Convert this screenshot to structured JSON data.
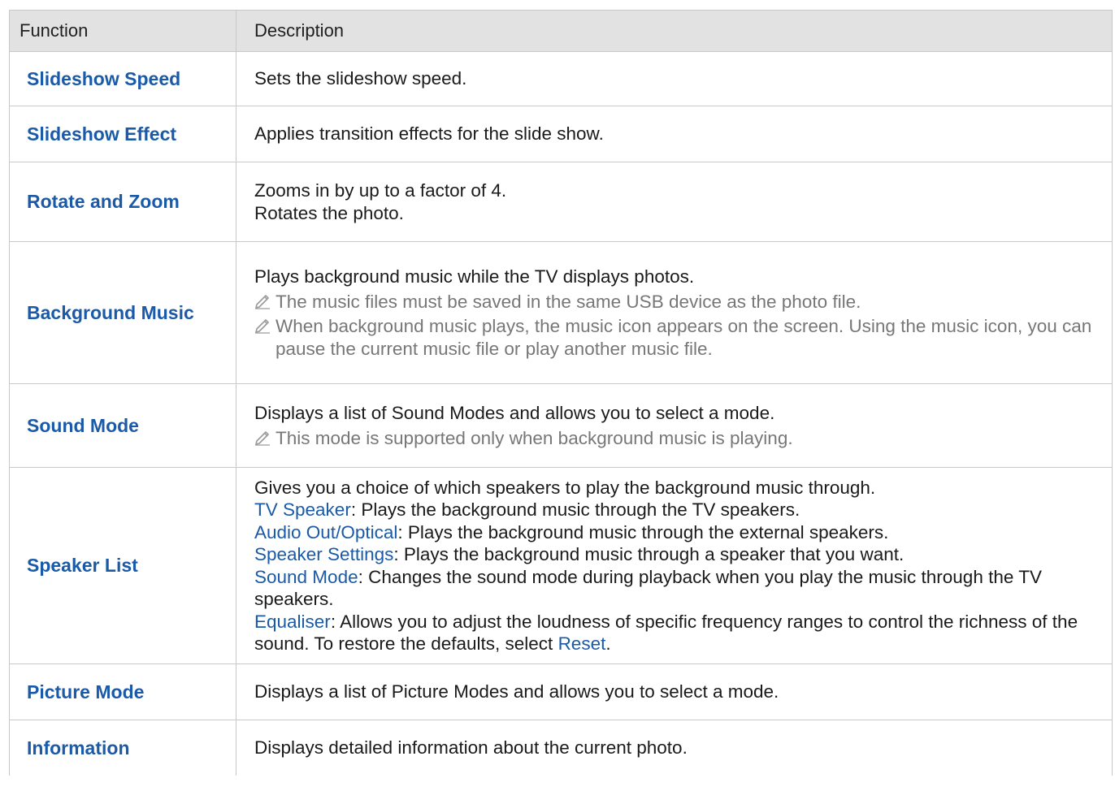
{
  "header": {
    "function_label": "Function",
    "description_label": "Description"
  },
  "rows": [
    {
      "function": "Slideshow Speed",
      "lines": [
        "Sets the slideshow speed."
      ]
    },
    {
      "function": "Slideshow Effect",
      "lines": [
        "Applies transition effects for the slide show."
      ]
    },
    {
      "function": "Rotate and Zoom",
      "lines": [
        "Zooms in by up to a factor of 4.",
        "Rotates the photo."
      ]
    },
    {
      "function": "Background Music",
      "lines": [
        "Plays background music while the TV displays photos."
      ],
      "notes": [
        "The music files must be saved in the same USB device as the photo file.",
        "When background music plays, the music icon appears on the screen. Using the music icon, you can pause the current music file or play another music file."
      ]
    },
    {
      "function": "Sound Mode",
      "lines": [
        "Displays a list of Sound Modes and allows you to select a mode."
      ],
      "notes": [
        "This mode is supported only when background music is playing."
      ]
    },
    {
      "function": "Speaker List",
      "lines": [
        "Gives you a choice of which speakers to play the background music through."
      ],
      "options": [
        {
          "term": "TV Speaker",
          "text": ": Plays the background music through the TV speakers."
        },
        {
          "term": "Audio Out/Optical",
          "text": ": Plays the background music through the external speakers."
        },
        {
          "term": "Speaker Settings",
          "text": ": Plays the background music through a speaker that you want."
        },
        {
          "term": "Sound Mode",
          "text": ": Changes the sound mode during playback when you play the music through the TV speakers."
        },
        {
          "term": "Equaliser",
          "text": ": Allows you to adjust the loudness of specific frequency ranges to control the richness of the sound. To restore the defaults, select ",
          "term2": "Reset",
          "end": "."
        }
      ]
    },
    {
      "function": "Picture Mode",
      "lines": [
        "Displays a list of Picture Modes and allows you to select a mode."
      ]
    },
    {
      "function": "Information",
      "lines": [
        "Displays detailed information about the current photo."
      ]
    }
  ],
  "colors": {
    "link_blue": "#1a5aa8",
    "note_gray": "#777777",
    "header_bg": "#e2e2e2",
    "border": "#c9c9c9"
  },
  "icons": {
    "note": "pencil-icon"
  }
}
